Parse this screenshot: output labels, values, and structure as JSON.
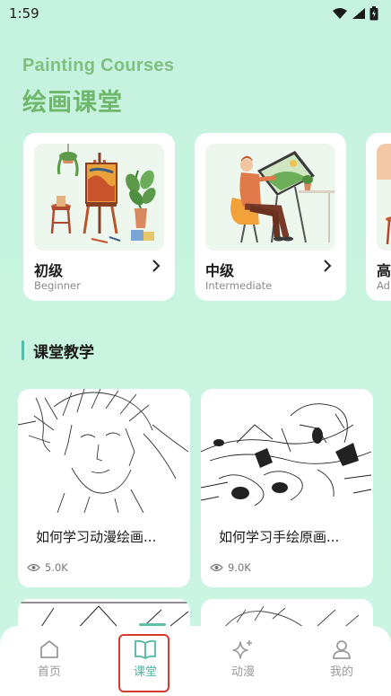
{
  "status_bar": {
    "time": "1:59"
  },
  "header": {
    "title_en": "Painting Courses",
    "title_zh": "绘画课堂"
  },
  "courses": [
    {
      "title": "初级",
      "subtitle": "Beginner"
    },
    {
      "title": "中级",
      "subtitle": "Intermediate"
    },
    {
      "title": "高",
      "subtitle": "Ad"
    }
  ],
  "section": {
    "title": "课堂教学"
  },
  "articles": [
    {
      "title": "如何学习动漫绘画...",
      "views": "5.0K"
    },
    {
      "title": "如何学习手绘原画...",
      "views": "9.0K"
    }
  ],
  "tabs": [
    {
      "label": "首页",
      "icon": "home-icon"
    },
    {
      "label": "课堂",
      "icon": "book-icon"
    },
    {
      "label": "动漫",
      "icon": "sparkle-icon"
    },
    {
      "label": "我的",
      "icon": "user-icon"
    }
  ],
  "colors": {
    "accent": "#4fb6a0",
    "header_green": "#6fb86a",
    "background": "#c6f3df",
    "highlight_box": "#d63a2c"
  }
}
